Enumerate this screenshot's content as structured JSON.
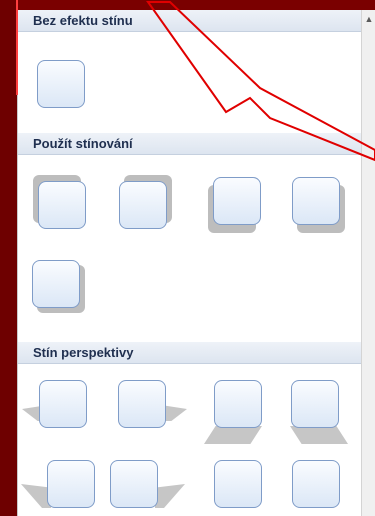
{
  "sections": [
    {
      "title": "Bez efektu stínu"
    },
    {
      "title": "Použít stínování"
    },
    {
      "title": "Stín perspektivy"
    }
  ],
  "colors": {
    "background": "#7a0000",
    "header_text": "#1f2f4f",
    "tile_border": "#7f9cc8",
    "callout_stroke": "#e00000"
  },
  "icons": {
    "scroll_up": "▲"
  }
}
